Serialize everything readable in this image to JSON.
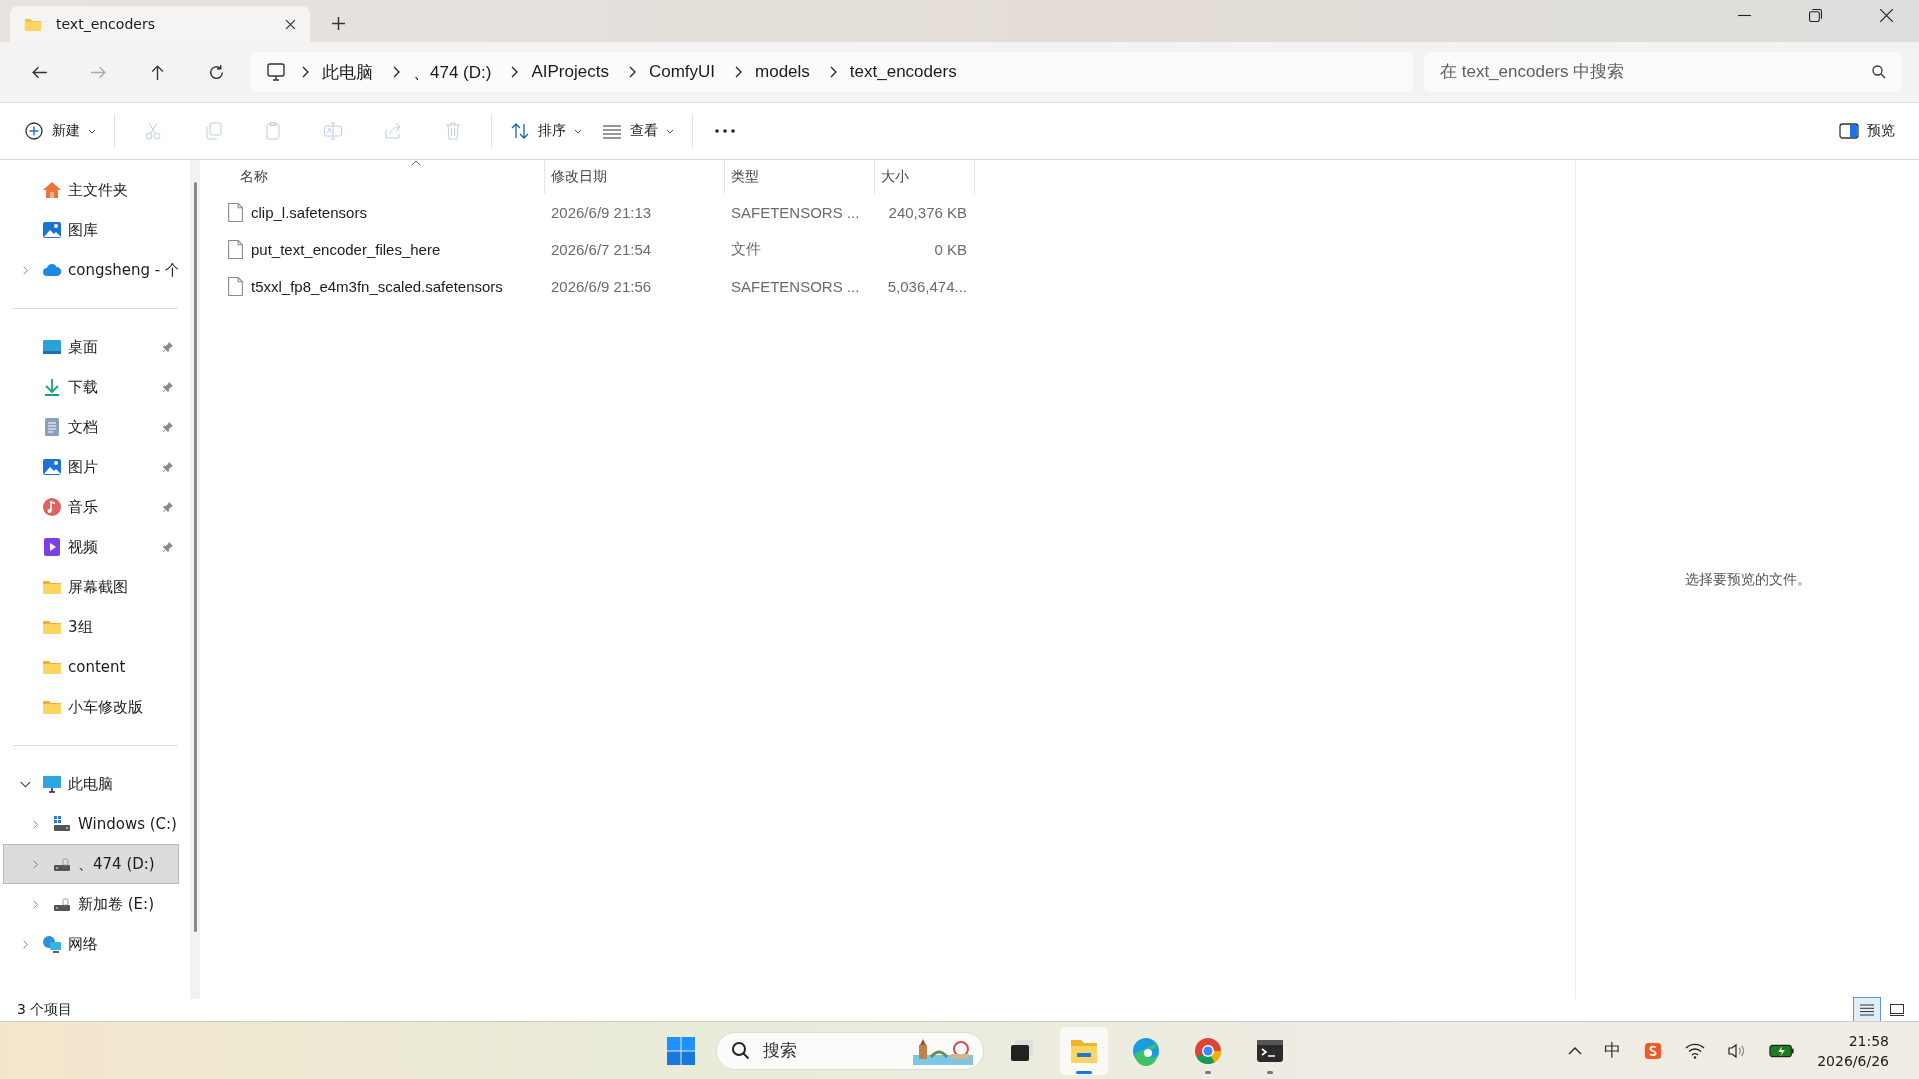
{
  "tab": {
    "title": "text_encoders"
  },
  "breadcrumb": [
    "此电脑",
    "、474 (D:)",
    "AIProjects",
    "ComfyUI",
    "models",
    "text_encoders"
  ],
  "search": {
    "placeholder": "在 text_encoders 中搜索"
  },
  "toolbar": {
    "new_label": "新建",
    "actions": [
      {
        "kind": "cut",
        "disabled": true
      },
      {
        "kind": "copy",
        "disabled": true
      },
      {
        "kind": "paste",
        "disabled": true
      },
      {
        "kind": "rename",
        "disabled": true
      },
      {
        "kind": "share",
        "disabled": true
      },
      {
        "kind": "delete",
        "disabled": true
      }
    ],
    "sort_label": "排序",
    "view_label": "查看",
    "preview_label": "预览"
  },
  "sidebar": {
    "groups": [
      [
        {
          "label": "主文件夹",
          "kind": "home",
          "selected": false
        },
        {
          "label": "图库",
          "kind": "gallery",
          "selected": false
        },
        {
          "label": "congsheng - 个",
          "kind": "cloud",
          "expanded": false,
          "selected": false
        }
      ],
      [
        {
          "label": "桌面",
          "kind": "desktop",
          "pinned": true,
          "selected": false
        },
        {
          "label": "下载",
          "kind": "download",
          "pinned": true,
          "selected": false
        },
        {
          "label": "文档",
          "kind": "docs",
          "pinned": true,
          "selected": false
        },
        {
          "label": "图片",
          "kind": "gallery",
          "pinned": true,
          "selected": false
        },
        {
          "label": "音乐",
          "kind": "music",
          "pinned": true,
          "selected": false
        },
        {
          "label": "视频",
          "kind": "video",
          "pinned": true,
          "selected": false
        },
        {
          "label": "屏幕截图",
          "kind": "folder",
          "pinned": false,
          "selected": false
        },
        {
          "label": "3组",
          "kind": "folder",
          "pinned": false,
          "selected": false
        },
        {
          "label": "content",
          "kind": "folder",
          "pinned": false,
          "selected": false
        },
        {
          "label": "小车修改版",
          "kind": "folder",
          "pinned": false,
          "selected": false
        }
      ],
      [
        {
          "label": "此电脑",
          "kind": "pc",
          "expanded": true,
          "selected": false,
          "children": [
            {
              "label": "Windows (C:)",
              "kind": "sysdrive",
              "expanded": false,
              "selected": false
            },
            {
              "label": "、474 (D:)",
              "kind": "drive",
              "expanded": false,
              "selected": true
            },
            {
              "label": "新加卷 (E:)",
              "kind": "drive",
              "expanded": false,
              "selected": false
            }
          ]
        },
        {
          "label": "网络",
          "kind": "network",
          "expanded": false,
          "selected": false
        }
      ]
    ]
  },
  "columns": [
    "名称",
    "修改日期",
    "类型",
    "大小"
  ],
  "files": [
    {
      "name": "clip_l.safetensors",
      "date": "2026/6/9 21:13",
      "type": "SAFETENSORS ...",
      "size": "240,376 KB"
    },
    {
      "name": "put_text_encoder_files_here",
      "date": "2026/6/7 21:54",
      "type": "文件",
      "size": "0 KB"
    },
    {
      "name": "t5xxl_fp8_e4m3fn_scaled.safetensors",
      "date": "2026/6/9 21:56",
      "type": "SAFETENSORS ...",
      "size": "5,036,474..."
    }
  ],
  "preview": {
    "message": "选择要预览的文件。"
  },
  "status": {
    "count": "3 个项目"
  },
  "view_modes": [
    {
      "kind": "details",
      "selected": true
    },
    {
      "kind": "tiles",
      "selected": false
    }
  ],
  "taskbar": {
    "search_placeholder": "搜索",
    "apps": [
      {
        "kind": "taskview",
        "running": false,
        "active": false
      },
      {
        "kind": "explorer",
        "running": true,
        "active": true
      },
      {
        "kind": "edge",
        "running": false,
        "active": false
      },
      {
        "kind": "chrome",
        "running": true,
        "active": false
      },
      {
        "kind": "terminal",
        "running": true,
        "active": false
      }
    ],
    "ime": "中",
    "time": "21:58",
    "date": "2026/6/26"
  }
}
